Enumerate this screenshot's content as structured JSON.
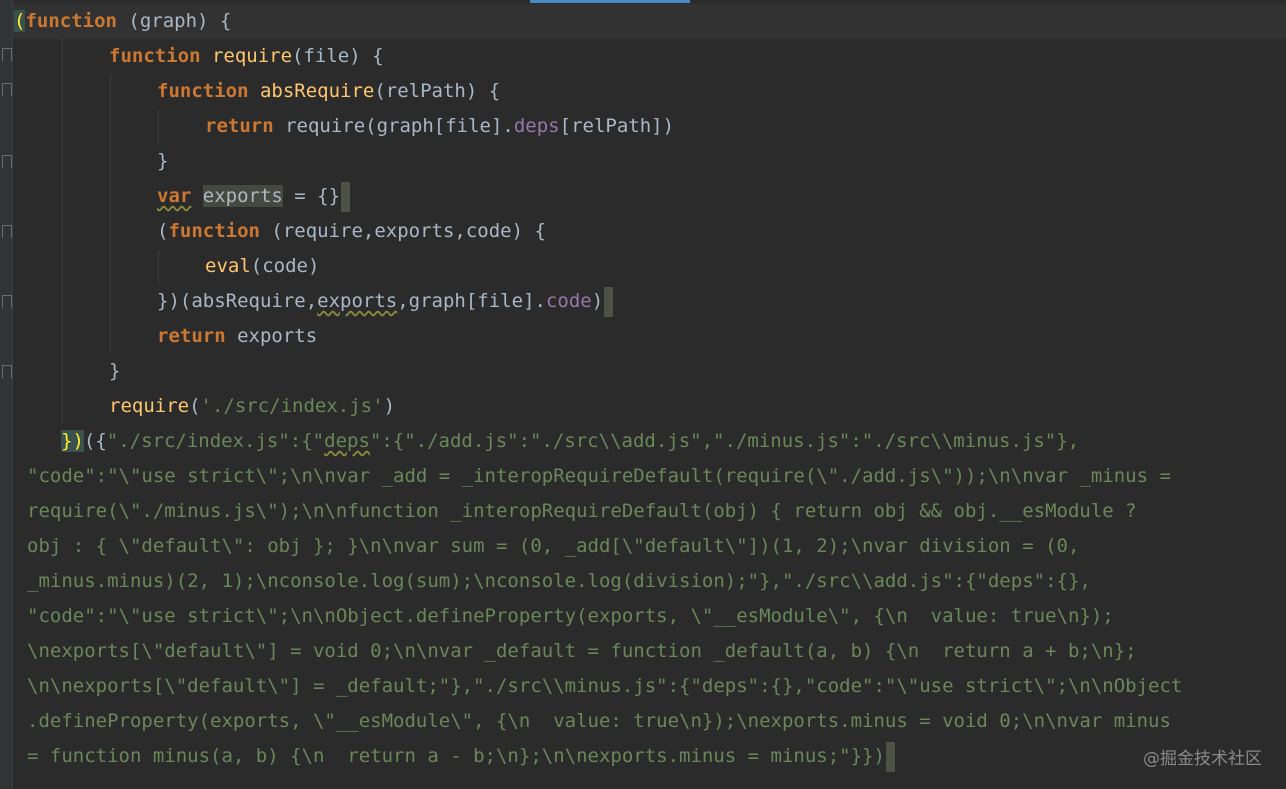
{
  "editor": {
    "lines": [
      [
        "(",
        "function",
        " (graph) {"
      ],
      [
        "function",
        " ",
        "require",
        "(file) {"
      ],
      [
        "function",
        " ",
        "absRequire",
        "(relPath) {"
      ],
      [
        "return",
        " require(graph[file].",
        "deps",
        "[relPath])"
      ],
      [
        "}"
      ],
      [
        "var",
        " ",
        "exports",
        " = {}"
      ],
      [
        "(",
        "function",
        " (require,exports,code) {"
      ],
      [
        "eval",
        "(code)"
      ],
      [
        "})(absRequire,",
        "exports",
        ",graph[file].",
        "code",
        ")"
      ],
      [
        "return",
        " exports"
      ],
      [
        "}"
      ],
      [
        "require",
        "(",
        "'./src/index.js'",
        ")"
      ],
      [
        "})",
        "({",
        "\"./src/index.js\":{\"",
        "deps",
        "\":{\"./add.js\":\"./src\\\\add.js\",\"./minus.js\":\"./src\\\\minus.js\"},"
      ],
      [
        "\"code\":\"\\\"use strict\\\";\\n\\nvar _add = _interopRequireDefault(require(\\\"./add.js\\\"));\\n\\nvar _minus ="
      ],
      [
        "require(\\\"./minus.js\\\");\\n\\nfunction _interopRequireDefault(obj) { return obj && obj.__esModule ?"
      ],
      [
        "obj : { \\\"default\\\": obj }; }\\n\\nvar sum = (0, _add[\\\"default\\\"])(1, 2);\\nvar division = (0,"
      ],
      [
        "_minus.minus)(2, 1);\\nconsole.log(sum);\\nconsole.log(division);\"},\"./src\\\\add.js\":{\"deps\":{},"
      ],
      [
        "\"code\":\"\\\"use strict\\\";\\n\\nObject.defineProperty(exports, \\\"__esModule\\\", {\\n  value: true\\n});"
      ],
      [
        "\\nexports[\\\"default\\\"] = void 0;\\n\\nvar _default = function _default(a, b) {\\n  return a + b;\\n};"
      ],
      [
        "\\n\\nexports[\\\"default\\\"] = _default;\"},\"./src\\\\minus.js\":{\"deps\":{},\"code\":\"\\\"use strict\\\";\\n\\nObject"
      ],
      [
        ".defineProperty(exports, \\\"__esModule\\\", {\\n  value: true\\n});\\nexports.minus = void 0;\\n\\nvar minus"
      ],
      [
        "= function minus(a, b) {\\n  return a - b;\\n};\\n\\nexports.minus = minus;\"}})"
      ]
    ]
  },
  "watermark": "@掘金技术社区"
}
